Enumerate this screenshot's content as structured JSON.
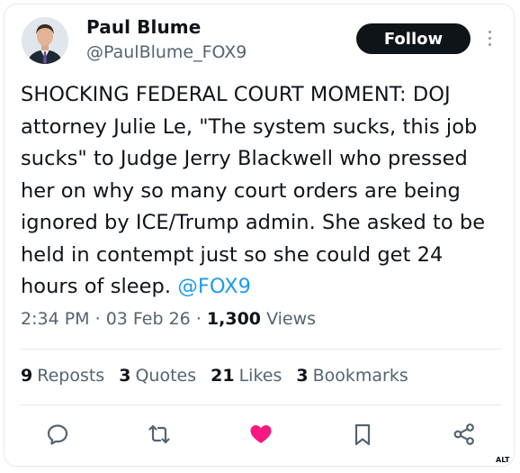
{
  "author": {
    "name": "Paul Blume",
    "handle": "@PaulBlume_FOX9"
  },
  "follow_label": "Follow",
  "tweet": {
    "text": "SHOCKING FEDERAL COURT MOMENT: DOJ attorney Julie Le, \"The system sucks, this job sucks\" to Judge Jerry Blackwell who pressed her on why so many court orders are being ignored by ICE/Trump admin. She asked to be held in contempt just so she could get 24 hours of sleep.",
    "mention": "@FOX9"
  },
  "meta": {
    "time": "2:34 PM",
    "separator": "·",
    "date": "03 Feb 26",
    "views_count": "1,300",
    "views_label": "Views"
  },
  "stats": {
    "reposts_count": "9",
    "reposts_label": "Reposts",
    "quotes_count": "3",
    "quotes_label": "Quotes",
    "likes_count": "21",
    "likes_label": "Likes",
    "bookmarks_count": "3",
    "bookmarks_label": "Bookmarks"
  },
  "actions": [
    "reply-icon",
    "retweet-icon",
    "like-icon",
    "bookmark-icon",
    "share-icon"
  ],
  "colors": {
    "like": "#f91880",
    "link": "#1d9bf0",
    "muted": "#536471",
    "text": "#0f1419"
  },
  "alt_badge": "ALT"
}
